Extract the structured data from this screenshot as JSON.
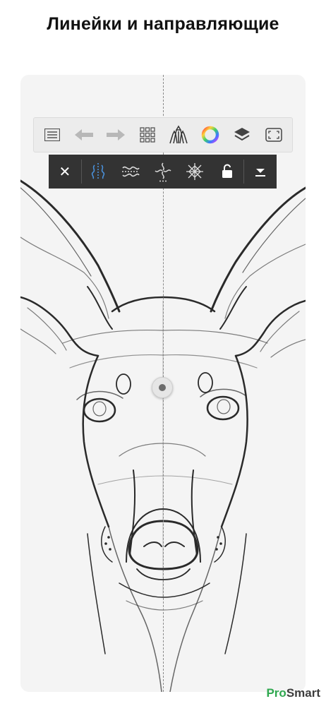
{
  "page": {
    "title": "Линейки и направляющие"
  },
  "toolbar": {
    "items": [
      {
        "name": "list-icon"
      },
      {
        "name": "undo-icon"
      },
      {
        "name": "redo-icon"
      },
      {
        "name": "grid-icon"
      },
      {
        "name": "brushes-icon"
      },
      {
        "name": "color-wheel-icon"
      },
      {
        "name": "layers-icon"
      },
      {
        "name": "fullscreen-icon"
      }
    ]
  },
  "guide_toolbar": {
    "close_glyph": "✕",
    "items": [
      "close-icon",
      "symmetry-mirror-icon",
      "symmetry-wave-icon",
      "symmetry-radial-icon",
      "symmetry-kaleidoscope-icon",
      "lock-icon",
      "collapse-icon"
    ],
    "active": "symmetry-mirror-icon",
    "active_color": "#4a90d9"
  },
  "watermark": {
    "pro": "Pro",
    "smart": "Smart"
  }
}
